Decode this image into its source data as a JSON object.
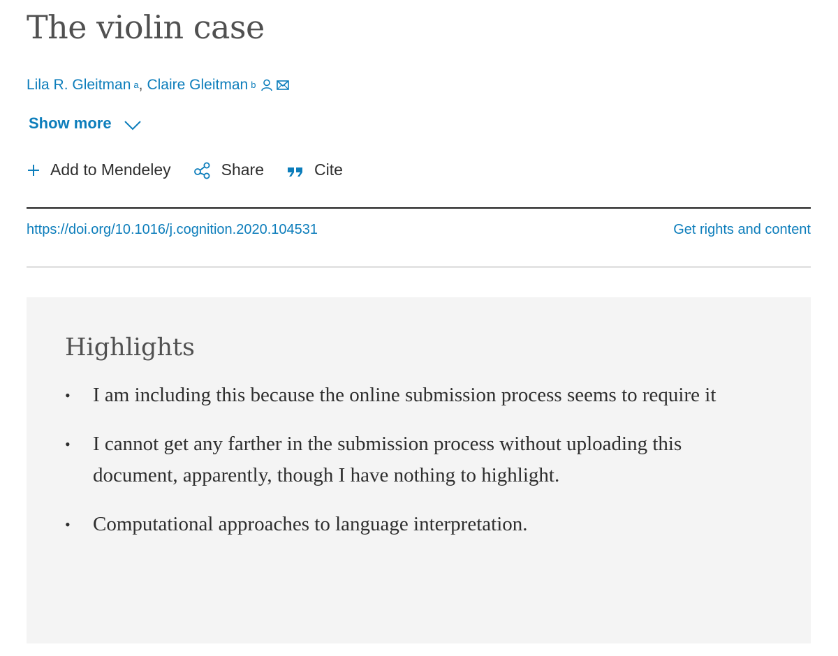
{
  "article": {
    "title": "The violin case",
    "authors": [
      {
        "name": "Lila R. Gleitman",
        "affiliation": "a"
      },
      {
        "name": "Claire Gleitman",
        "affiliation": "b"
      }
    ],
    "author_separator": ",",
    "show_more_label": "Show more",
    "doi": "https://doi.org/10.1016/j.cognition.2020.104531",
    "rights_label": "Get rights and content"
  },
  "actions": {
    "mendeley_label": "Add to Mendeley",
    "share_label": "Share",
    "cite_label": "Cite"
  },
  "highlights": {
    "heading": "Highlights",
    "bullet": "•",
    "items": [
      "I am including this because the online submission process seems to require it",
      "I cannot get any farther in the submission process without uploading this document, apparently, though I have nothing to highlight.",
      "Computational approaches to language interpretation."
    ]
  },
  "colors": {
    "link": "#0c7dbb",
    "title": "#505050",
    "text": "#2e2e2e",
    "highlights_bg": "#f4f4f4"
  },
  "icons": {
    "person": "person-icon",
    "email": "envelope-icon",
    "chevron": "chevron-down-icon",
    "plus": "plus-icon",
    "share": "share-icon",
    "cite": "quote-icon"
  }
}
